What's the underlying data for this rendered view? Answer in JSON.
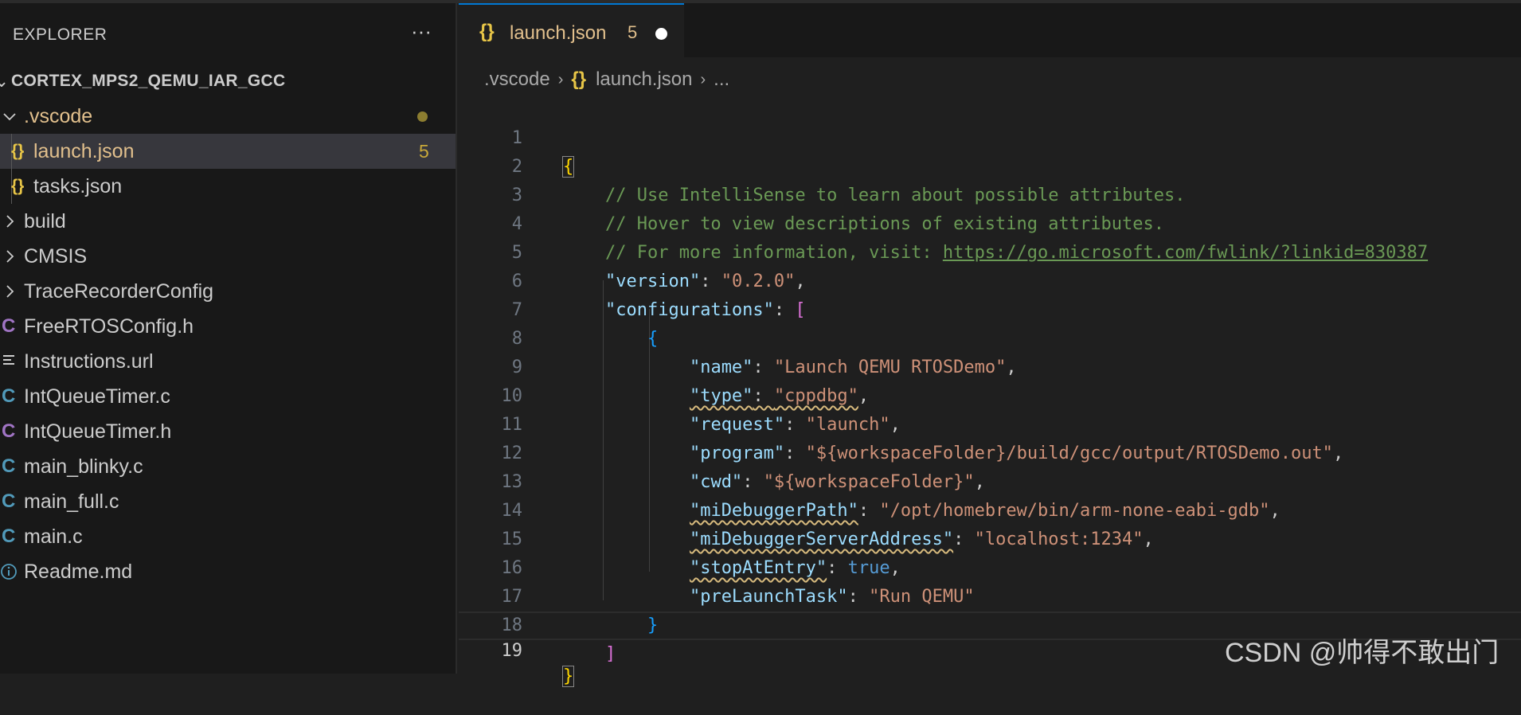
{
  "sidebar": {
    "title": "EXPLORER",
    "more_glyph": "···",
    "root": "CORTEX_MPS2_QEMU_IAR_GCC",
    "items": [
      {
        "label": ".vscode",
        "kind": "folder-open",
        "icon": "chevron-down-icon",
        "modified": true
      },
      {
        "label": "launch.json",
        "kind": "json",
        "icon": "json-icon",
        "badge": "5",
        "selected": true
      },
      {
        "label": "tasks.json",
        "kind": "json",
        "icon": "json-icon"
      },
      {
        "label": "build",
        "kind": "folder",
        "icon": "chevron-right-icon"
      },
      {
        "label": "CMSIS",
        "kind": "folder",
        "icon": "chevron-right-icon"
      },
      {
        "label": "TraceRecorderConfig",
        "kind": "folder",
        "icon": "chevron-right-icon"
      },
      {
        "label": "FreeRTOSConfig.h",
        "kind": "h",
        "icon": "c-header-icon"
      },
      {
        "label": "Instructions.url",
        "kind": "url",
        "icon": "lines-icon"
      },
      {
        "label": "IntQueueTimer.c",
        "kind": "c",
        "icon": "c-file-icon"
      },
      {
        "label": "IntQueueTimer.h",
        "kind": "h",
        "icon": "c-header-icon"
      },
      {
        "label": "main_blinky.c",
        "kind": "c",
        "icon": "c-file-icon"
      },
      {
        "label": "main_full.c",
        "kind": "c",
        "icon": "c-file-icon"
      },
      {
        "label": "main.c",
        "kind": "c",
        "icon": "c-file-icon"
      },
      {
        "label": "Readme.md",
        "kind": "md",
        "icon": "info-icon"
      }
    ]
  },
  "tab": {
    "icon": "{}",
    "name": "launch.json",
    "count": "5"
  },
  "breadcrumb": {
    "folder": ".vscode",
    "icon": "{}",
    "file": "launch.json",
    "tail": "..."
  },
  "editor": {
    "current_line": 19,
    "lines": [
      "{",
      "    // Use IntelliSense to learn about possible attributes.",
      "    // Hover to view descriptions of existing attributes.",
      "    // For more information, visit: https://go.microsoft.com/fwlink/?linkid=830387",
      "    \"version\": \"0.2.0\",",
      "    \"configurations\": [",
      "        {",
      "            \"name\": \"Launch QEMU RTOSDemo\",",
      "            \"type\": \"cppdbg\",",
      "            \"request\": \"launch\",",
      "            \"program\": \"${workspaceFolder}/build/gcc/output/RTOSDemo.out\",",
      "            \"cwd\": \"${workspaceFolder}\",",
      "            \"miDebuggerPath\": \"/opt/homebrew/bin/arm-none-eabi-gdb\",",
      "            \"miDebuggerServerAddress\": \"localhost:1234\",",
      "            \"stopAtEntry\": true,",
      "            \"preLaunchTask\": \"Run QEMU\"",
      "        }",
      "    ]",
      "}"
    ],
    "comments": {
      "c1": "// Use IntelliSense to learn about possible attributes.",
      "c2": "// Hover to view descriptions of existing attributes.",
      "c3": "// For more information, visit: ",
      "link": "https://go.microsoft.com/fwlink/?linkid=830387"
    },
    "props": {
      "version": {
        "key": "\"version\"",
        "val": "\"0.2.0\""
      },
      "configurations": {
        "key": "\"configurations\""
      },
      "name": {
        "key": "\"name\"",
        "val": "\"Launch QEMU RTOSDemo\""
      },
      "type": {
        "key": "\"type\"",
        "val": "\"cppdbg\""
      },
      "request": {
        "key": "\"request\"",
        "val": "\"launch\""
      },
      "program": {
        "key": "\"program\"",
        "val": "\"${workspaceFolder}/build/gcc/output/RTOSDemo.out\""
      },
      "cwd": {
        "key": "\"cwd\"",
        "val": "\"${workspaceFolder}\""
      },
      "miDebuggerPath": {
        "key": "\"miDebuggerPath\"",
        "val": "\"/opt/homebrew/bin/arm-none-eabi-gdb\""
      },
      "miDebuggerServerAddress": {
        "key": "\"miDebuggerServerAddress\"",
        "val": "\"localhost:1234\""
      },
      "stopAtEntry": {
        "key": "\"stopAtEntry\"",
        "val": "true"
      },
      "preLaunchTask": {
        "key": "\"preLaunchTask\"",
        "val": "\"Run QEMU\""
      }
    }
  },
  "watermark": "CSDN @帅得不敢出门",
  "colors": {
    "accent": "#0078d4",
    "json_icon": "#e7c547",
    "c_icon": "#519aba",
    "h_icon": "#a074c4",
    "comment": "#6a9955",
    "string": "#ce9178",
    "key": "#9cdcfe"
  }
}
